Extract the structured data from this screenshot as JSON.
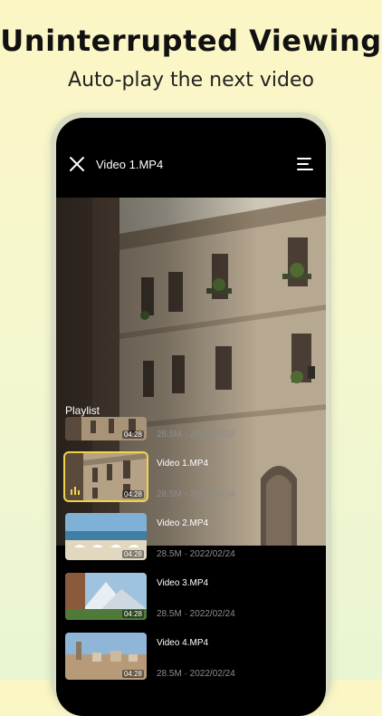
{
  "promo": {
    "headline": "Uninterrupted Viewing",
    "subheadline": "Auto-play the next video"
  },
  "player": {
    "title": "Video 1.MP4",
    "close_icon": "close-icon",
    "menu_icon": "playlist-menu-icon",
    "playlist_label": "Playlist",
    "items": [
      {
        "name": "",
        "duration": "04:28",
        "meta": "28.5M · 2022/02/24",
        "active": false
      },
      {
        "name": "Video 1.MP4",
        "duration": "04:28",
        "meta": "28.5M · 2022/02/24",
        "active": true
      },
      {
        "name": "Video 2.MP4",
        "duration": "04:28",
        "meta": "28.5M · 2022/02/24",
        "active": false
      },
      {
        "name": "Video 3.MP4",
        "duration": "04:28",
        "meta": "28.5M · 2022/02/24",
        "active": false
      },
      {
        "name": "Video 4.MP4",
        "duration": "04:28",
        "meta": "28.5M · 2022/02/24",
        "active": false
      }
    ]
  },
  "colors": {
    "accent_highlight": "#f1d44b",
    "background_top": "#fbf6c4",
    "background_bottom": "#e9f6d2"
  }
}
